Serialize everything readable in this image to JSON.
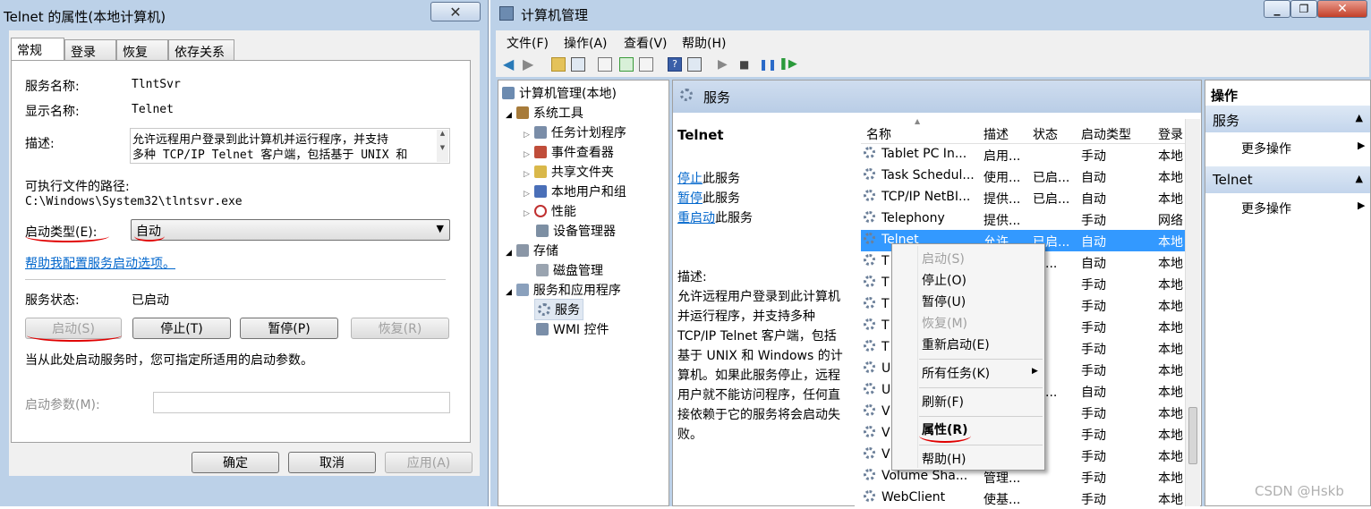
{
  "dialog": {
    "title": "Telnet 的属性(本地计算机)",
    "tabs": [
      "常规",
      "登录",
      "恢复",
      "依存关系"
    ],
    "service_name_label": "服务名称:",
    "service_name": "TlntSvr",
    "display_name_label": "显示名称:",
    "display_name": "Telnet",
    "description_label": "描述:",
    "description_line1": "允许远程用户登录到此计算机并运行程序，并支持",
    "description_line2": "多种 TCP/IP Telnet 客户端，包括基于 UNIX 和",
    "exe_path_label": "可执行文件的路径:",
    "exe_path": "C:\\Windows\\System32\\tlntsvr.exe",
    "startup_type_label": "启动类型(E):",
    "startup_type_value": "自动",
    "help_link": "帮助我配置服务启动选项。",
    "status_label": "服务状态:",
    "status_value": "已启动",
    "btn_start": "启动(S)",
    "btn_stop": "停止(T)",
    "btn_pause": "暂停(P)",
    "btn_resume": "恢复(R)",
    "params_hint": "当从此处启动服务时，您可指定所适用的启动参数。",
    "params_label": "启动参数(M):",
    "params_value": "",
    "btn_ok": "确定",
    "btn_cancel": "取消",
    "btn_apply": "应用(A)"
  },
  "window": {
    "title": "计算机管理",
    "menus": [
      "文件(F)",
      "操作(A)",
      "查看(V)",
      "帮助(H)"
    ]
  },
  "tree": {
    "root": "计算机管理(本地)",
    "system_tools": "系统工具",
    "task_scheduler": "任务计划程序",
    "event_viewer": "事件查看器",
    "shared_folders": "共享文件夹",
    "local_users": "本地用户和组",
    "performance": "性能",
    "device_manager": "设备管理器",
    "storage": "存储",
    "disk_mgmt": "磁盘管理",
    "services_apps": "服务和应用程序",
    "services": "服务",
    "wmi": "WMI 控件"
  },
  "services_panel": {
    "header": "服务",
    "selected_name": "Telnet",
    "stop_link": "停止",
    "stop_suffix": "此服务",
    "pause_link": "暂停",
    "pause_suffix": "此服务",
    "restart_link": "重启动",
    "restart_suffix": "此服务",
    "desc_label": "描述:",
    "desc_lines": [
      "允许远程用户登录到此计算机",
      "并运行程序，并支持多种",
      "TCP/IP Telnet 客户端，包括",
      "基于 UNIX 和 Windows 的计",
      "算机。如果此服务停止，远程",
      "用户就不能访问程序，任何直",
      "接依赖于它的服务将会启动失",
      "败。"
    ],
    "columns": [
      "名称",
      "描述",
      "状态",
      "启动类型",
      "登录"
    ],
    "rows": [
      [
        "Tablet PC In...",
        "启用...",
        "",
        "手动",
        "本地"
      ],
      [
        "Task Schedul...",
        "使用...",
        "已启...",
        "自动",
        "本地"
      ],
      [
        "TCP/IP NetBI...",
        "提供...",
        "已启...",
        "自动",
        "本地"
      ],
      [
        "Telephony",
        "提供...",
        "",
        "手动",
        "网络"
      ],
      [
        "Telnet",
        "允许...",
        "已启...",
        "自动",
        "本地"
      ],
      [
        "T",
        "",
        "启...",
        "自动",
        "本地"
      ],
      [
        "T",
        "",
        "",
        "手动",
        "本地"
      ],
      [
        "T",
        "",
        "",
        "手动",
        "本地"
      ],
      [
        "T",
        "",
        "",
        "手动",
        "本地"
      ],
      [
        "T",
        "",
        "",
        "手动",
        "本地"
      ],
      [
        "U",
        "",
        "",
        "手动",
        "本地"
      ],
      [
        "U",
        "",
        "启...",
        "自动",
        "本地"
      ],
      [
        "V",
        "",
        "",
        "手动",
        "本地"
      ],
      [
        "V",
        "",
        "",
        "手动",
        "本地"
      ],
      [
        "V",
        "",
        "",
        "手动",
        "本地"
      ],
      [
        "Volume Sha...",
        "管理...",
        "",
        "手动",
        "本地"
      ],
      [
        "WebClient",
        "使基...",
        "",
        "手动",
        "本地"
      ]
    ]
  },
  "context_menu": {
    "start": "启动(S)",
    "stop": "停止(O)",
    "pause": "暂停(U)",
    "resume": "恢复(M)",
    "restart": "重新启动(E)",
    "all_tasks": "所有任务(K)",
    "refresh": "刷新(F)",
    "properties": "属性(R)",
    "help": "帮助(H)"
  },
  "actions": {
    "title": "操作",
    "section1": "服务",
    "more1": "更多操作",
    "section2": "Telnet",
    "more2": "更多操作"
  },
  "watermark": "CSDN @Hskb",
  "colors": {
    "selection": "#3399ff",
    "link": "#0066cc",
    "annotation": "#e00000"
  }
}
